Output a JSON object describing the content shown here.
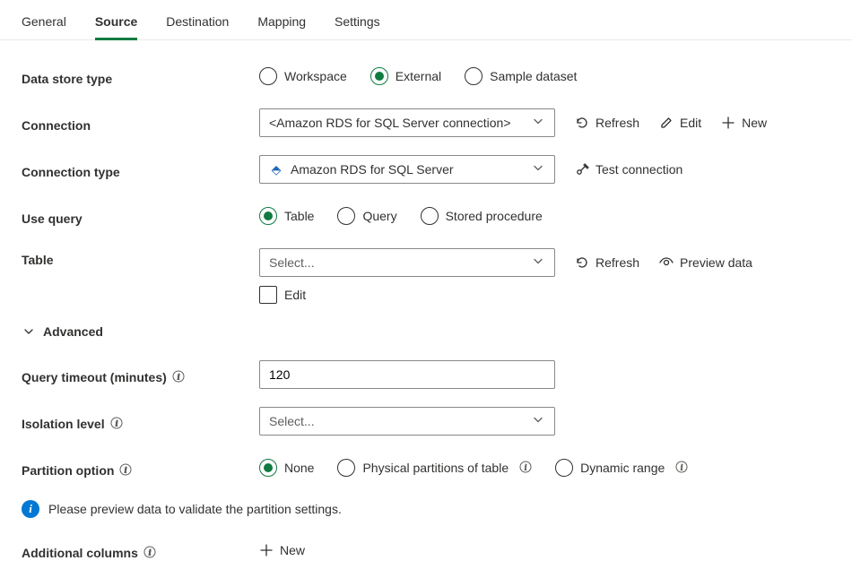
{
  "tabs": [
    "General",
    "Source",
    "Destination",
    "Mapping",
    "Settings"
  ],
  "activeTab": "Source",
  "fields": {
    "dataStoreType": {
      "label": "Data store type",
      "options": [
        "Workspace",
        "External",
        "Sample dataset"
      ],
      "selected": "External"
    },
    "connection": {
      "label": "Connection",
      "value": "<Amazon RDS for SQL Server connection>",
      "actions": {
        "refresh": "Refresh",
        "edit": "Edit",
        "new": "New"
      }
    },
    "connectionType": {
      "label": "Connection type",
      "value": "Amazon RDS for SQL Server",
      "action": "Test connection"
    },
    "useQuery": {
      "label": "Use query",
      "options": [
        "Table",
        "Query",
        "Stored procedure"
      ],
      "selected": "Table"
    },
    "table": {
      "label": "Table",
      "placeholder": "Select...",
      "editCheckbox": "Edit",
      "actions": {
        "refresh": "Refresh",
        "preview": "Preview data"
      }
    },
    "advanced": "Advanced",
    "queryTimeout": {
      "label": "Query timeout (minutes)",
      "value": "120"
    },
    "isolationLevel": {
      "label": "Isolation level",
      "placeholder": "Select..."
    },
    "partitionOption": {
      "label": "Partition option",
      "options": [
        "None",
        "Physical partitions of table",
        "Dynamic range"
      ],
      "selected": "None"
    },
    "partitionNote": "Please preview data to validate the partition settings.",
    "additionalColumns": {
      "label": "Additional columns",
      "action": "New"
    }
  }
}
